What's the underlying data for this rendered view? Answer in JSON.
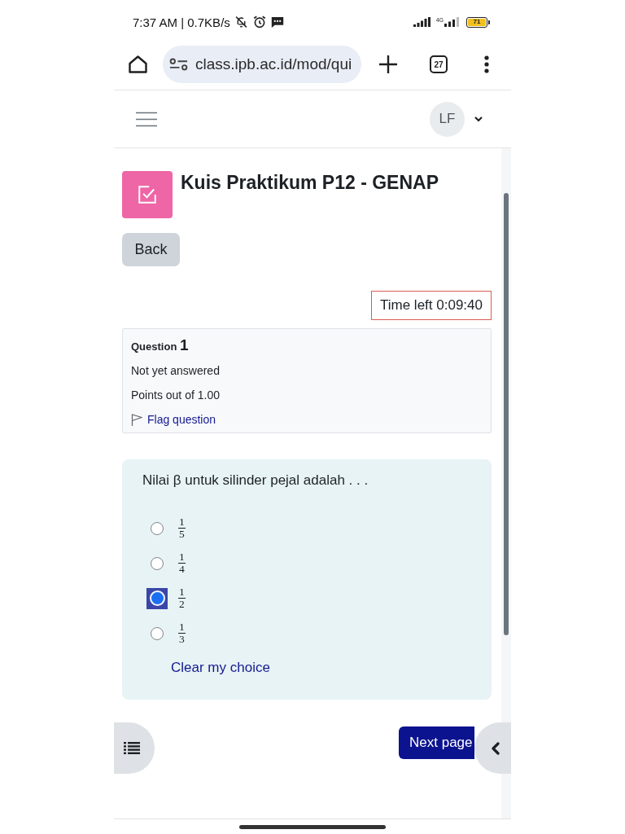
{
  "status_bar": {
    "text": "7:37 AM | 0.7KB/s",
    "network": "4G",
    "battery": "71"
  },
  "browser": {
    "url": "class.ipb.ac.id/mod/qui",
    "tab_count": "27"
  },
  "navbar": {
    "avatar": "LF"
  },
  "page": {
    "title": "Kuis Praktikum P12 - GENAP",
    "back_button": "Back",
    "timer": "Time left 0:09:40"
  },
  "question_info": {
    "label": "Question",
    "number": "1",
    "status": "Not yet answered",
    "points": "Points out of 1.00",
    "flag": {
      "label": "Flag question",
      "flagged": false
    }
  },
  "question": {
    "text": "Nilai β untuk silinder pejal adalah . . .",
    "options": [
      {
        "numerator": "1",
        "denominator": "5",
        "selected": false
      },
      {
        "numerator": "1",
        "denominator": "4",
        "selected": false
      },
      {
        "numerator": "1",
        "denominator": "2",
        "selected": true
      },
      {
        "numerator": "1",
        "denominator": "3",
        "selected": false
      }
    ],
    "clear_link": "Clear my choice"
  },
  "navigation": {
    "next_button": "Next page"
  }
}
